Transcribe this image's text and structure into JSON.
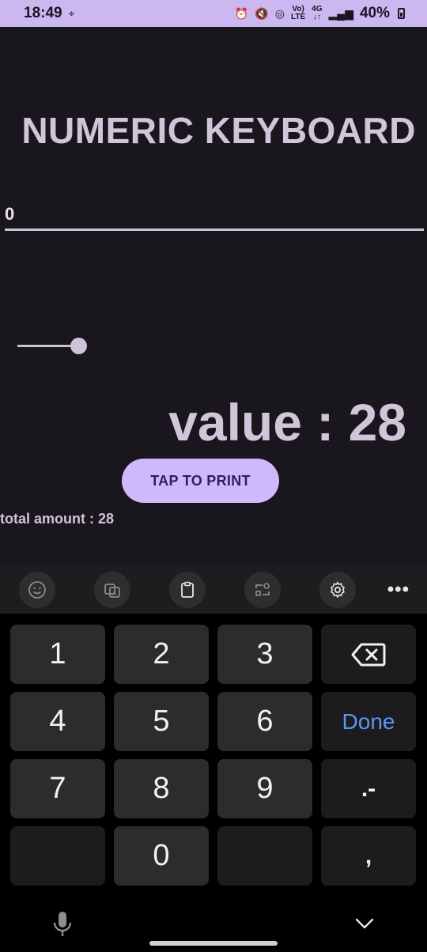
{
  "status_bar": {
    "time": "18:49",
    "signal_label_top": "Vo)",
    "signal_label_bottom": "LTE",
    "network_top": "4G",
    "network_bottom": "↓↑",
    "battery": "40%"
  },
  "app": {
    "title": "NUMERIC KEYBOARD",
    "input_value": "0",
    "slider_value": 28,
    "value_text": "value : 28",
    "print_button": "TAP TO PRINT",
    "total_text": "total amount : 28"
  },
  "keyboard": {
    "toolbar_icons": [
      "emoji-icon",
      "translate-icon",
      "clipboard-icon",
      "text-convert-icon",
      "settings-icon",
      "more-icon"
    ],
    "more_label": "•••",
    "keys": {
      "k1": "1",
      "k2": "2",
      "k3": "3",
      "k4": "4",
      "k5": "5",
      "k6": "6",
      "k7": "7",
      "k8": "8",
      "k9": "9",
      "k0": "0",
      "done": "Done",
      "dot_minus": ".-",
      "comma": ","
    },
    "done_color": "#5f95f0"
  }
}
